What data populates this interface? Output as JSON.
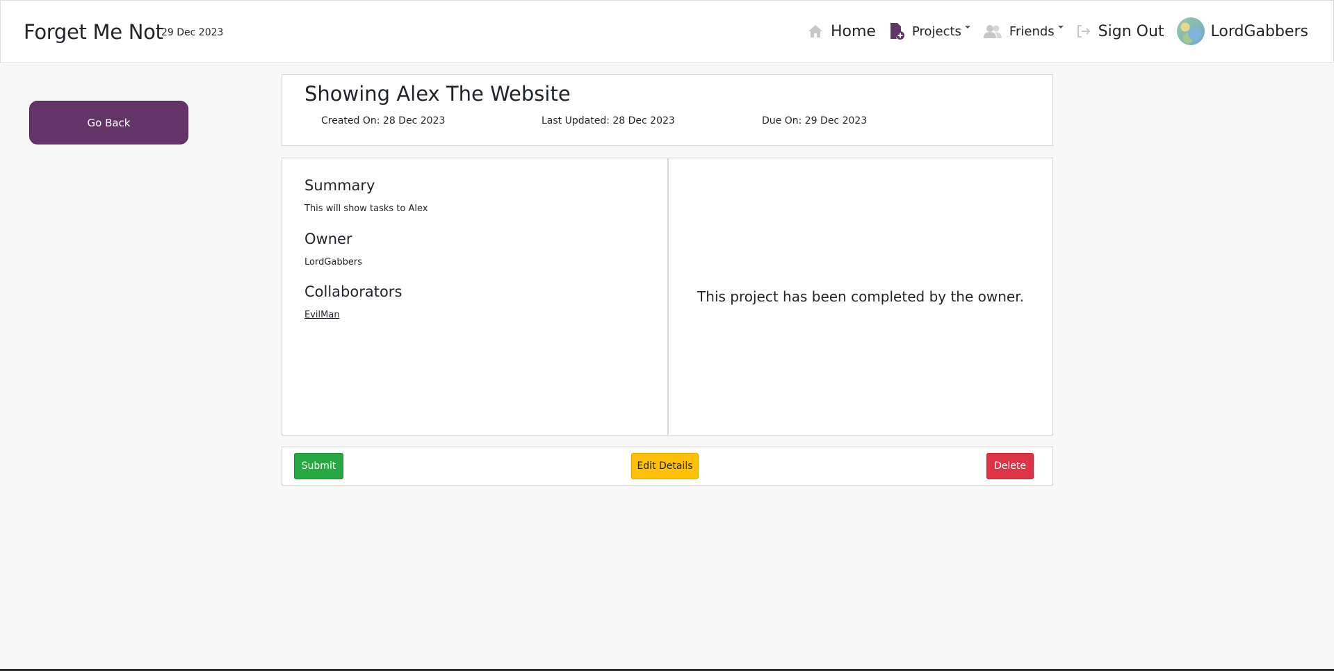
{
  "navbar": {
    "brand": "Forget Me Not",
    "date": "29 Dec 2023",
    "items": [
      {
        "label": "Home",
        "icon": "home-icon"
      },
      {
        "label": "Projects",
        "icon": "project-add-icon",
        "dropdown": true
      },
      {
        "label": "Friends",
        "icon": "friends-icon",
        "dropdown": true
      },
      {
        "label": "Sign Out",
        "icon": "sign-out-icon"
      }
    ],
    "user": "LordGabbers"
  },
  "sidebar": {
    "go_back_label": "Go Back"
  },
  "project": {
    "title": "Showing Alex The Website",
    "created_on": "Created On: 28 Dec 2023",
    "last_updated": "Last Updated: 28 Dec 2023",
    "due_on": "Due On: 29 Dec 2023",
    "summary_heading": "Summary",
    "summary_text": "This will show tasks to Alex",
    "owner_heading": "Owner",
    "owner_name": "LordGabbers",
    "collaborators_heading": "Collaborators",
    "collaborators": [
      "EvilMan"
    ],
    "status_message": "This project has been completed by the owner."
  },
  "actions": {
    "submit_label": "Submit",
    "edit_label": "Edit Details",
    "delete_label": "Delete"
  },
  "colors": {
    "brand_purple": "#633468",
    "submit_green": "#28a745",
    "edit_yellow": "#ffc107",
    "delete_red": "#dc3545"
  }
}
